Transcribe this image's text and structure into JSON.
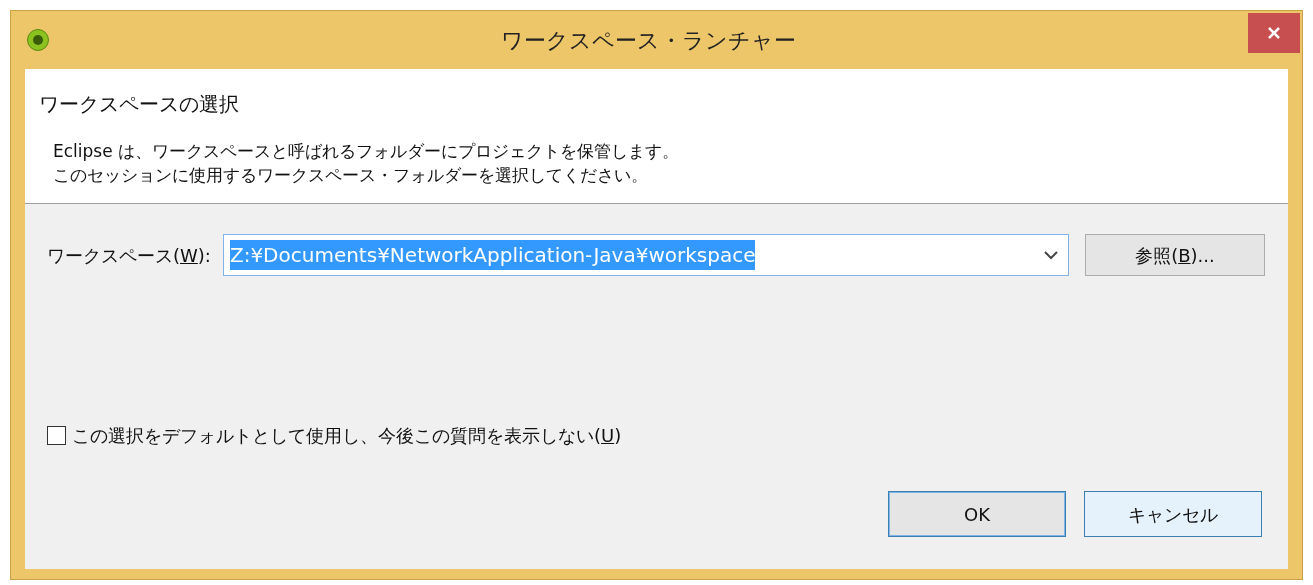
{
  "window": {
    "title": "ワークスペース・ランチャー"
  },
  "header": {
    "title": "ワークスペースの選択",
    "lines": [
      "Eclipse は、ワークスペースと呼ばれるフォルダーにプロジェクトを保管します。",
      "このセッションに使用するワークスペース・フォルダーを選択してください。"
    ]
  },
  "workspace": {
    "label": {
      "before": "ワークスペース(",
      "mnemonic": "W",
      "after": "):"
    },
    "value": "Z:¥Documents¥NetworkApplication-Java¥workspace",
    "text_selected": true,
    "browse": {
      "before": "参照(",
      "mnemonic": "B",
      "after": ")..."
    }
  },
  "checkbox": {
    "label": {
      "before": "この選択をデフォルトとして使用し、今後この質問を表示しない(",
      "mnemonic": "U",
      "after": ")"
    },
    "checked": false
  },
  "buttons": [
    {
      "label": "OK",
      "default": true,
      "hovered": false
    },
    {
      "label": "キャンセル",
      "default": false,
      "hovered": true
    }
  ]
}
